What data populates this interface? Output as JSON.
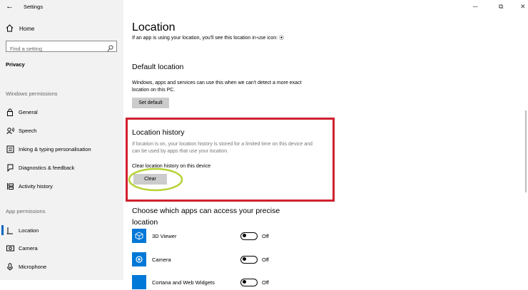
{
  "window": {
    "title": "Settings",
    "back": "←",
    "minimize": "─",
    "maximize": "⧉",
    "close": "✕"
  },
  "sidebar": {
    "home": "Home",
    "search_placeholder": "Find a setting",
    "category": "Privacy",
    "windows_permissions_label": "Windows permissions",
    "windows_items": [
      {
        "label": "General",
        "icon": "lock-icon"
      },
      {
        "label": "Speech",
        "icon": "speech-icon"
      },
      {
        "label": "Inking & typing personalisation",
        "icon": "inking-icon"
      },
      {
        "label": "Diagnostics & feedback",
        "icon": "feedback-icon"
      },
      {
        "label": "Activity history",
        "icon": "activity-icon"
      }
    ],
    "app_permissions_label": "App permissions",
    "app_items": [
      {
        "label": "Location",
        "icon": "location-icon",
        "active": true
      },
      {
        "label": "Camera",
        "icon": "camera-icon"
      },
      {
        "label": "Microphone",
        "icon": "microphone-icon"
      }
    ]
  },
  "main": {
    "title": "Location",
    "in_use_text": "If an app is using your location, you'll see this location in-use icon: ⦿",
    "default_location": {
      "title": "Default location",
      "desc": "Windows, apps and services can use this when we can't detect a more exact location on this PC.",
      "button": "Set default"
    },
    "location_history": {
      "title": "Location history",
      "desc": "If location is on, your location history is stored for a limited time on this device and can be used by apps that use your location.",
      "clear_label": "Clear location history on this device",
      "button": "Clear"
    },
    "choose_apps": {
      "title": "Choose which apps can access your precise location",
      "apps": [
        {
          "name": "3D Viewer",
          "state": "Off"
        },
        {
          "name": "Camera",
          "state": "Off"
        },
        {
          "name": "Cortana and Web Widgets",
          "state": "Off"
        }
      ]
    }
  },
  "colors": {
    "accent": "#0067c0",
    "highlight_box": "#d0202e",
    "circle": "#b5d334",
    "app_tile": "#0078d7"
  }
}
